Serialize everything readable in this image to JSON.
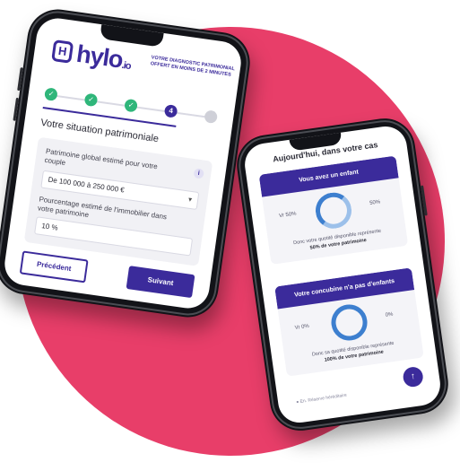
{
  "colors": {
    "background_circle": "#e83e69",
    "brand": "#3b2b9b",
    "success": "#2fb67a",
    "donut": "#3d7fcf"
  },
  "phone1": {
    "logo": {
      "mark": "H",
      "name": "hylo",
      "suffix": ".io"
    },
    "tagline": "VOTRE DIAGNOSTIC PATRIMONIAL OFFERT EN MOINS DE 2 MINUTES",
    "steps": [
      {
        "label": "✓",
        "state": "done"
      },
      {
        "label": "✓",
        "state": "done"
      },
      {
        "label": "✓",
        "state": "done"
      },
      {
        "label": "4",
        "state": "active"
      },
      {
        "label": "",
        "state": "todo"
      }
    ],
    "section_title": "Votre situation patrimoniale",
    "field1": {
      "label": "Patrimoine global estimé pour votre couple",
      "value": "De 100 000 à 250 000 €",
      "info_icon": "info-icon"
    },
    "field2": {
      "label": "Pourcentage estimé de l'immobilier dans votre patrimoine",
      "value": "10 %"
    },
    "prev_label": "Précédent",
    "next_label": "Suivant"
  },
  "phone2": {
    "title": "Aujourd'hui, dans votre cas",
    "card1": {
      "heading": "Vous avez un enfant",
      "left_pct": "Vr 50%",
      "right_pct": "50%",
      "note": "Donc votre quotité disponible représente",
      "note_bold": "50% de votre patrimoine"
    },
    "card2": {
      "heading": "Votre concubine n'a pas d'enfants",
      "left_pct": "Vr 0%",
      "right_pct": "0%",
      "note": "Donc sa quotité disponible représente",
      "note_bold": "100% de votre patrimoine"
    },
    "fab_icon": "arrow-up-icon",
    "footer_link": "● En. Réserve héréditaire"
  }
}
